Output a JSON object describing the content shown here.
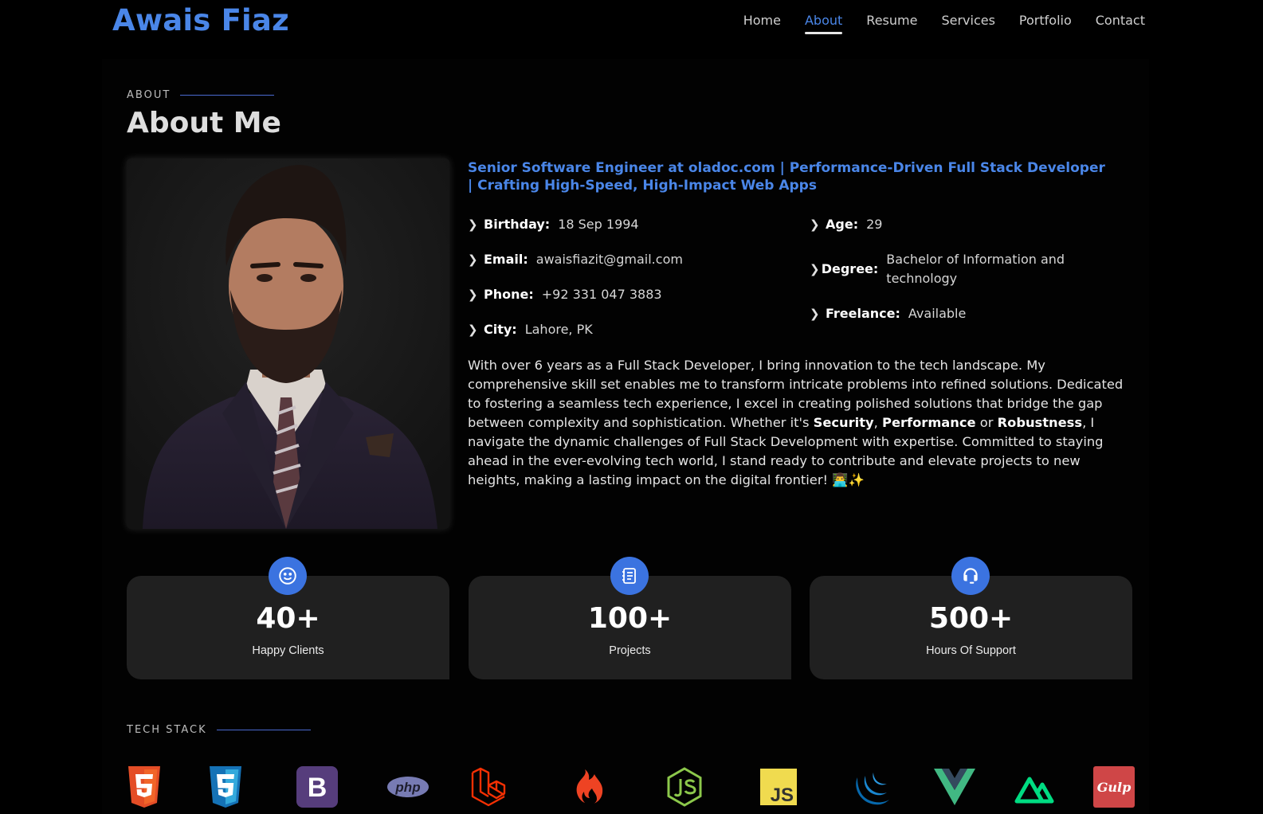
{
  "header": {
    "logo": "Awais Fiaz",
    "nav": [
      {
        "label": "Home",
        "active": false
      },
      {
        "label": "About",
        "active": true
      },
      {
        "label": "Resume",
        "active": false
      },
      {
        "label": "Services",
        "active": false
      },
      {
        "label": "Portfolio",
        "active": false
      },
      {
        "label": "Contact",
        "active": false
      }
    ]
  },
  "about": {
    "kicker": "ABOUT",
    "title": "About Me",
    "headline": "Senior Software Engineer at oladoc.com | Performance-Driven Full Stack Developer | Crafting High-Speed, High-Impact Web Apps",
    "info_left": [
      {
        "key": "Birthday:",
        "value": "18 Sep 1994"
      },
      {
        "key": "Email:",
        "value": "awaisfiazit@gmail.com"
      },
      {
        "key": "Phone:",
        "value": "+92 331 047 3883"
      },
      {
        "key": "City:",
        "value": "Lahore, PK"
      }
    ],
    "info_right": [
      {
        "key": "Age:",
        "value": "29"
      },
      {
        "key": "Degree:",
        "value": "Bachelor of Information and technology"
      },
      {
        "key": "Freelance:",
        "value": "Available"
      }
    ],
    "bio": {
      "part1": "With over 6 years as a Full Stack Developer, I bring innovation to the tech landscape. My comprehensive skill set enables me to transform intricate problems into refined solutions. Dedicated to fostering a seamless tech experience, I excel in creating polished solutions that bridge the gap between complexity and sophistication. Whether it's ",
      "bold1": "Security",
      "sep1": ", ",
      "bold2": "Performance",
      "sep2": " or ",
      "bold3": "Robustness",
      "part2": ", I navigate the dynamic challenges of Full Stack Development with expertise. Committed to staying ahead in the ever-evolving tech world, I stand ready to contribute and elevate projects to new heights, making a lasting impact on the digital frontier! 👨‍💻✨"
    }
  },
  "stats": [
    {
      "icon": "smiley-icon",
      "number": "40+",
      "label": "Happy Clients"
    },
    {
      "icon": "journal-icon",
      "number": "100+",
      "label": "Projects"
    },
    {
      "icon": "headset-icon",
      "number": "500+",
      "label": "Hours Of Support"
    }
  ],
  "tech_stack": {
    "kicker": "TECH STACK",
    "logos": [
      "html5-icon",
      "css3-icon",
      "bootstrap-icon",
      "php-icon",
      "laravel-icon",
      "codeigniter-icon",
      "nodejs-icon",
      "javascript-icon",
      "jquery-icon",
      "vue-icon",
      "nuxt-icon",
      "gulp-icon"
    ],
    "php_text": "php",
    "js_text": "JS",
    "gulp_text": "Gulp",
    "bootstrap_text": "B"
  },
  "colors": {
    "accent": "#4a86e8",
    "card": "#202020",
    "background": "#000000"
  }
}
